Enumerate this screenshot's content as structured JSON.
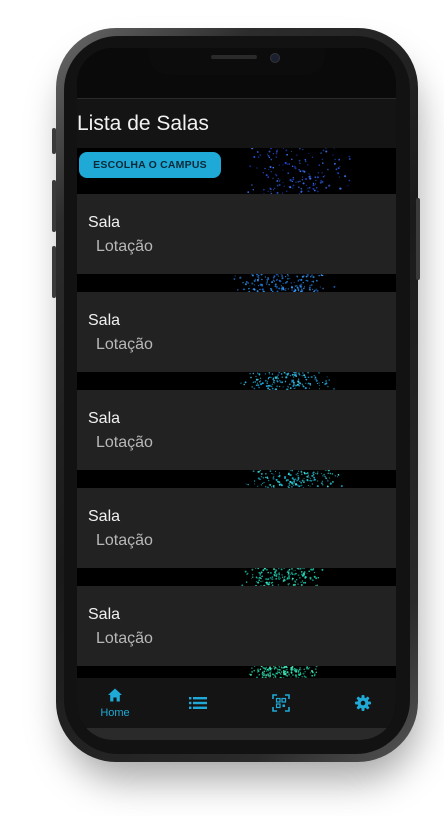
{
  "app": {
    "title": "Lista de Salas"
  },
  "toolbar": {
    "campus_button_label": "ESCOLHA O CAMPUS"
  },
  "rooms": [
    {
      "name": "Sala",
      "capacity_label": "Lotação"
    },
    {
      "name": "Sala",
      "capacity_label": "Lotação"
    },
    {
      "name": "Sala",
      "capacity_label": "Lotação"
    },
    {
      "name": "Sala",
      "capacity_label": "Lotação"
    },
    {
      "name": "Sala",
      "capacity_label": "Lotação"
    }
  ],
  "bottom_nav": {
    "items": [
      {
        "id": "home",
        "label": "Home",
        "icon": "home-icon",
        "active": true
      },
      {
        "id": "list",
        "label": "",
        "icon": "list-icon",
        "active": false
      },
      {
        "id": "scan",
        "label": "",
        "icon": "qr-scan-icon",
        "active": false
      },
      {
        "id": "settings",
        "label": "",
        "icon": "gear-icon",
        "active": false
      }
    ]
  },
  "colors": {
    "accent": "#1ea9d6",
    "card_background": "#222222",
    "background": "#000000"
  }
}
